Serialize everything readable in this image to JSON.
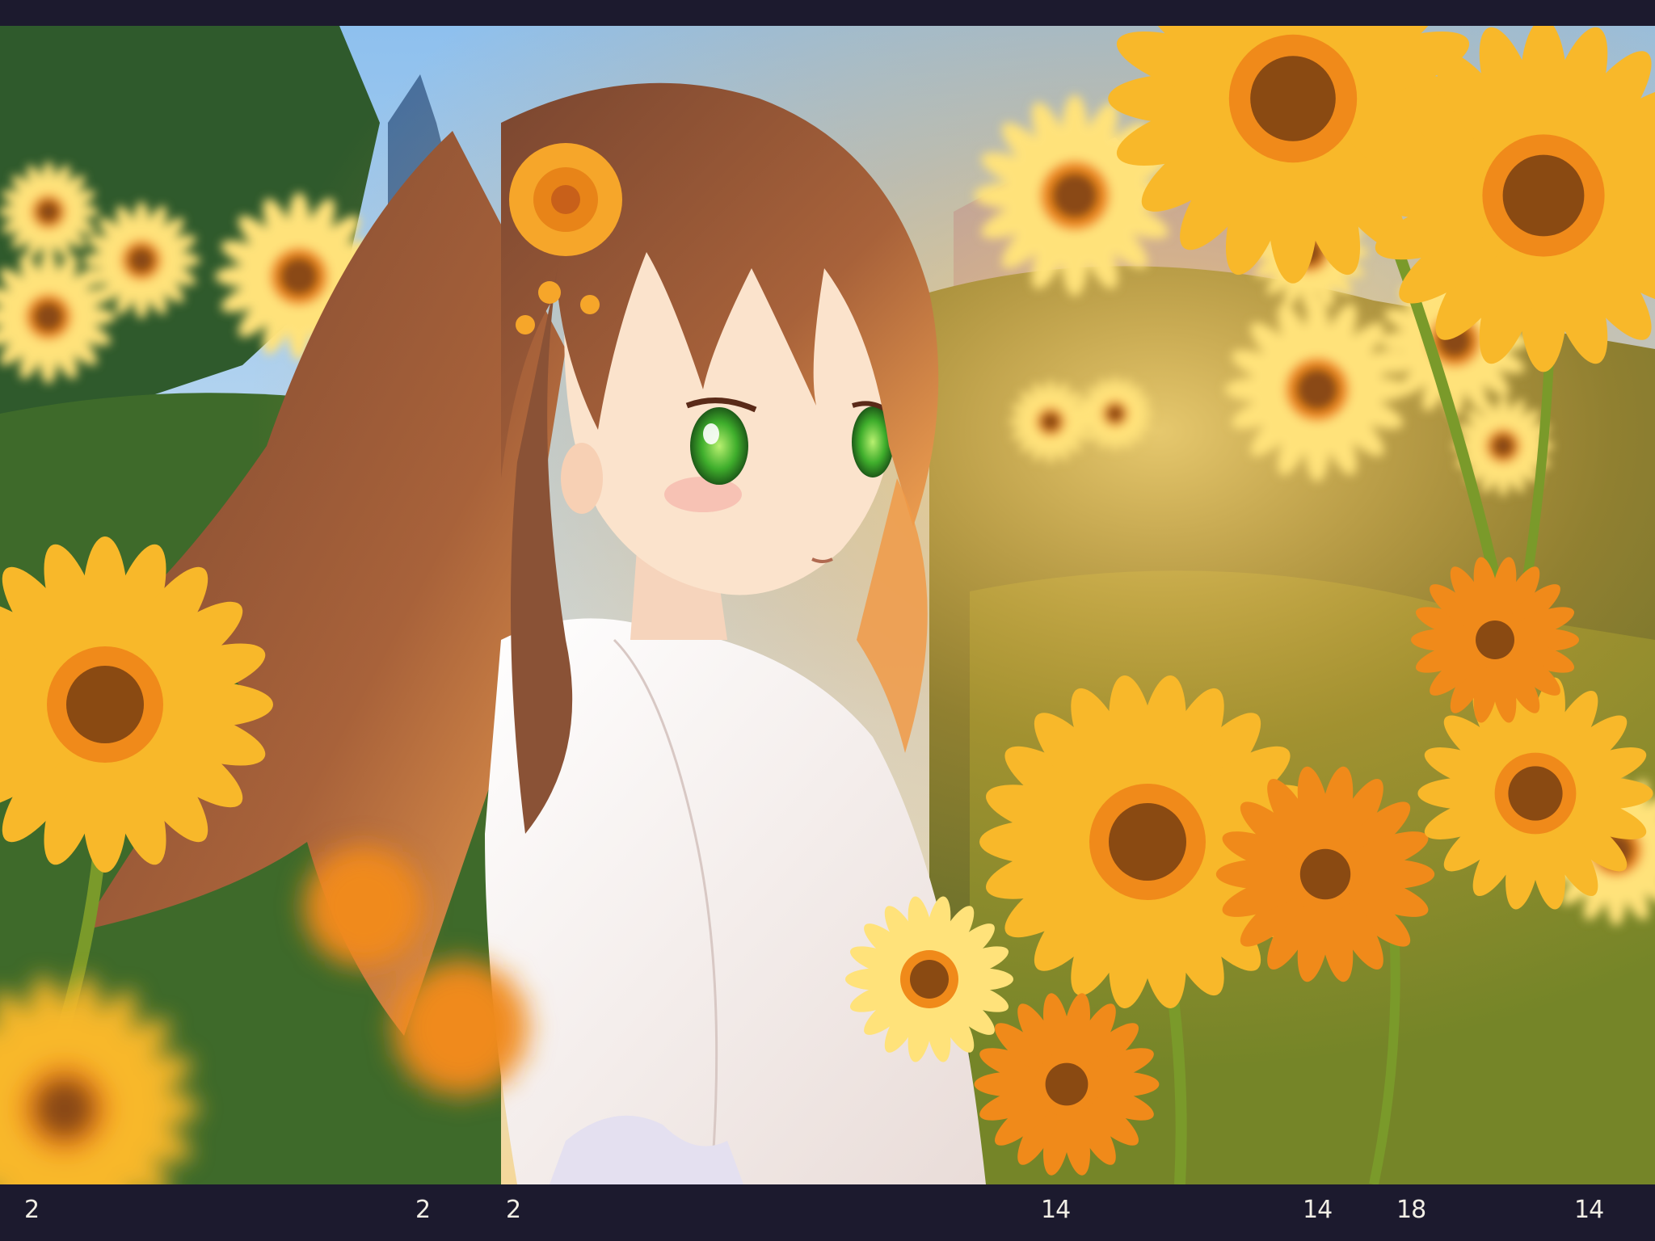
{
  "scene": {
    "subject": "anime-girl",
    "palette": {
      "sky": "#9cc8f0",
      "sky_light": "#e8f2f6",
      "foliage_dark": "#2f5a2c",
      "foliage_mid": "#6d8f2e",
      "petal": "#f8b82a",
      "petal_light": "#ffe27a",
      "petal_orange": "#f08a1a",
      "flower_center": "#8a4a12",
      "hair": "#8a5236",
      "hair_light": "#e8a058",
      "skin": "#fbe3cc",
      "eye": "#3fae2c",
      "dress": "#f6ece8",
      "frame": "#1c1a2e"
    }
  },
  "filmstrip": {
    "numbers": [
      "2",
      "2",
      "2",
      "14",
      "14",
      "18",
      "14"
    ]
  }
}
